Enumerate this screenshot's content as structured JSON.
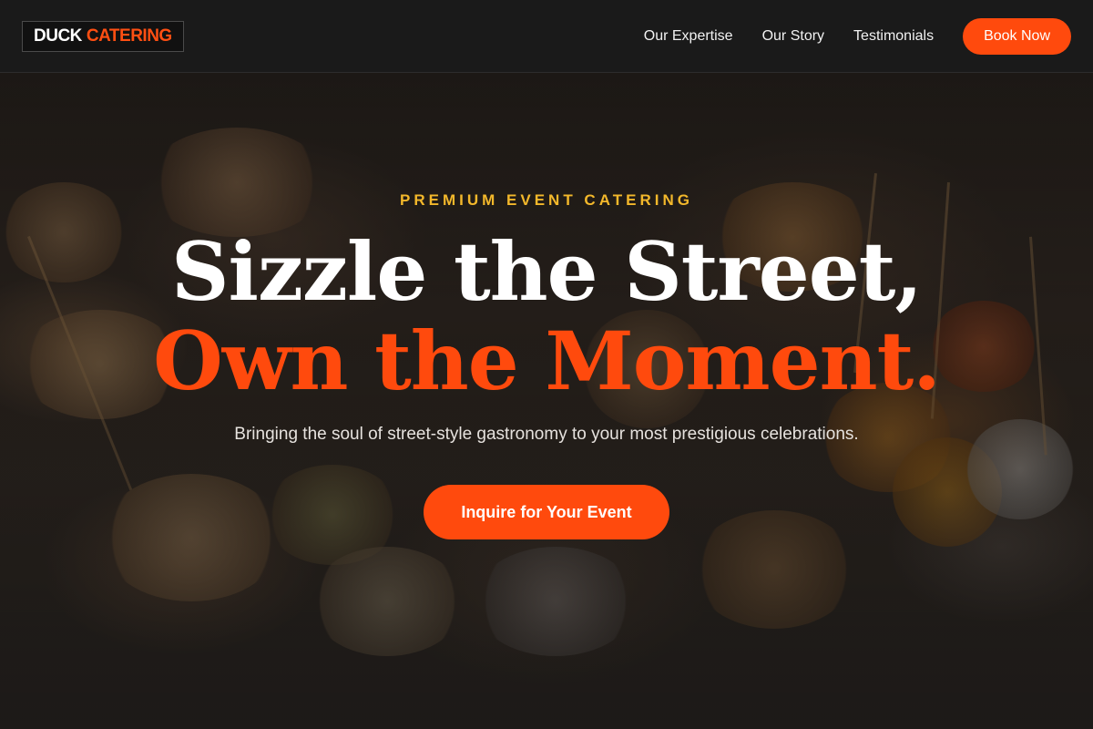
{
  "brand": {
    "word1": "DUCK",
    "word2": "CATERING",
    "accent_color": "#ff4a0d"
  },
  "nav": {
    "links": [
      "Our Expertise",
      "Our Story",
      "Testimonials"
    ],
    "cta_label": "Book Now"
  },
  "hero": {
    "eyebrow": "PREMIUM EVENT CATERING",
    "headline_line1": "Sizzle the Street,",
    "headline_line2": "Own the Moment.",
    "subtitle": "Bringing the soul of street-style gastronomy to your most prestigious celebrations.",
    "cta_label": "Inquire for Your Event",
    "eyebrow_color": "#f3b82b",
    "background": "blurred catering food platter photo"
  }
}
